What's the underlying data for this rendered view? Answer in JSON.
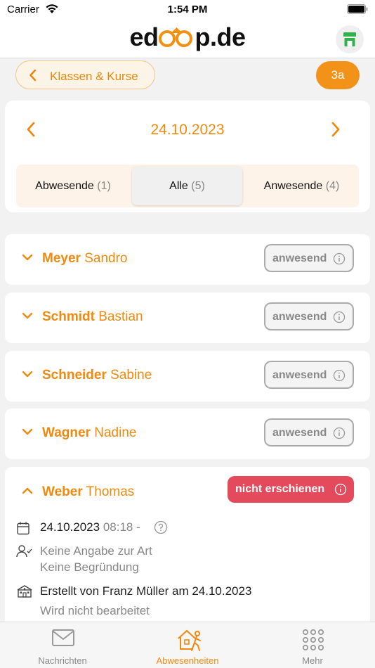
{
  "status_bar": {
    "carrier": "Carrier",
    "time": "1:54 PM"
  },
  "header": {
    "logo_prefix": "ed",
    "logo_suffix": "p.de"
  },
  "topbar": {
    "back_label": "Klassen & Kurse",
    "class_label": "3a"
  },
  "date_picker": {
    "date": "24.10.2023"
  },
  "segments": [
    {
      "label": "Abwesende",
      "count": "(1)"
    },
    {
      "label": "Alle",
      "count": "(5)"
    },
    {
      "label": "Anwesende",
      "count": "(4)"
    }
  ],
  "selected_segment": "Alle",
  "students": [
    {
      "last": "Meyer",
      "first": "Sandro",
      "status": "anwesend"
    },
    {
      "last": "Schmidt",
      "first": "Bastian",
      "status": "anwesend"
    },
    {
      "last": "Schneider",
      "first": "Sabine",
      "status": "anwesend"
    },
    {
      "last": "Wagner",
      "first": "Nadine",
      "status": "anwesend"
    }
  ],
  "expanded_student": {
    "last": "Weber",
    "first": "Thomas",
    "status": "nicht erschienen",
    "date": "24.10.2023",
    "time": "08:18 -",
    "type": "Keine Angabe zur Art",
    "reason": "Keine Begründung",
    "created_by": "Erstellt von Franz Müller am 24.10.2023",
    "processing": "Wird nicht bearbeitet"
  },
  "tabs": [
    {
      "label": "Nachrichten",
      "icon": "mail-icon"
    },
    {
      "label": "Abwesenheiten",
      "icon": "absence-icon"
    },
    {
      "label": "Mehr",
      "icon": "grid-icon"
    }
  ],
  "colors": {
    "accent": "#f0890e",
    "absent": "#e34a5c",
    "store": "#2db34a"
  }
}
